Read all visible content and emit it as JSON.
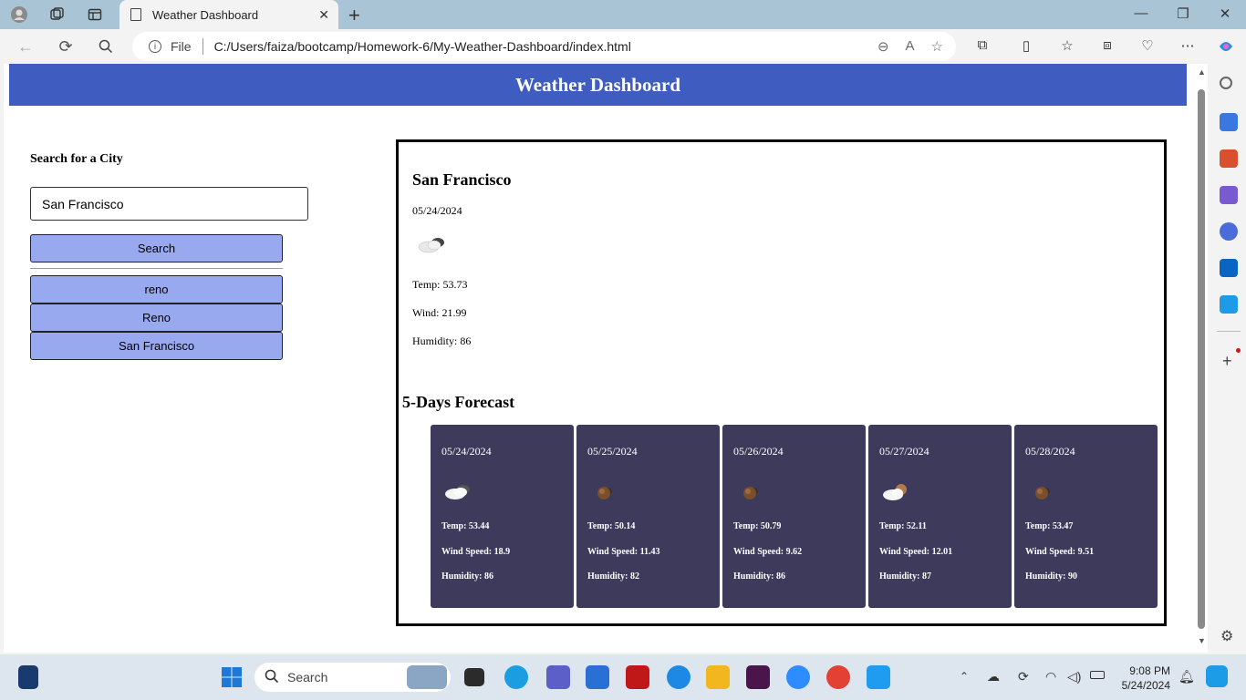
{
  "browser": {
    "tab_title": "Weather Dashboard",
    "file_label": "File",
    "url": "C:/Users/faiza/bootcamp/Homework-6/My-Weather-Dashboard/index.html"
  },
  "page": {
    "header_title": "Weather Dashboard",
    "search_heading": "Search for a City",
    "search_value": "San Francisco",
    "search_button": "Search",
    "history": [
      "reno",
      "Reno",
      "San Francisco"
    ]
  },
  "current": {
    "city": "San Francisco",
    "date": "05/24/2024",
    "icon": "cloud-icon",
    "temp": "Temp: 53.73",
    "wind": "Wind: 21.99",
    "humidity": "Humidity: 86"
  },
  "forecast": {
    "title": "5-Days Forecast",
    "days": [
      {
        "date": "05/24/2024",
        "icon": "cloud-icon",
        "temp": "Temp: 53.44",
        "wind": "Wind Speed: 18.9",
        "humidity": "Humidity: 86"
      },
      {
        "date": "05/25/2024",
        "icon": "dark-cloud-icon",
        "temp": "Temp: 50.14",
        "wind": "Wind Speed: 11.43",
        "humidity": "Humidity: 82"
      },
      {
        "date": "05/26/2024",
        "icon": "dark-cloud-icon",
        "temp": "Temp: 50.79",
        "wind": "Wind Speed: 9.62",
        "humidity": "Humidity: 86"
      },
      {
        "date": "05/27/2024",
        "icon": "partly-cloudy-icon",
        "temp": "Temp: 52.11",
        "wind": "Wind Speed: 12.01",
        "humidity": "Humidity: 87"
      },
      {
        "date": "05/28/2024",
        "icon": "dark-cloud-icon",
        "temp": "Temp: 53.47",
        "wind": "Wind Speed: 9.51",
        "humidity": "Humidity: 90"
      }
    ]
  },
  "taskbar": {
    "search_placeholder": "Search",
    "time": "9:08 PM",
    "date": "5/24/2024"
  },
  "colors": {
    "header": "#3f5dc0",
    "button": "#98a9ef",
    "card": "#3d3a5c"
  }
}
